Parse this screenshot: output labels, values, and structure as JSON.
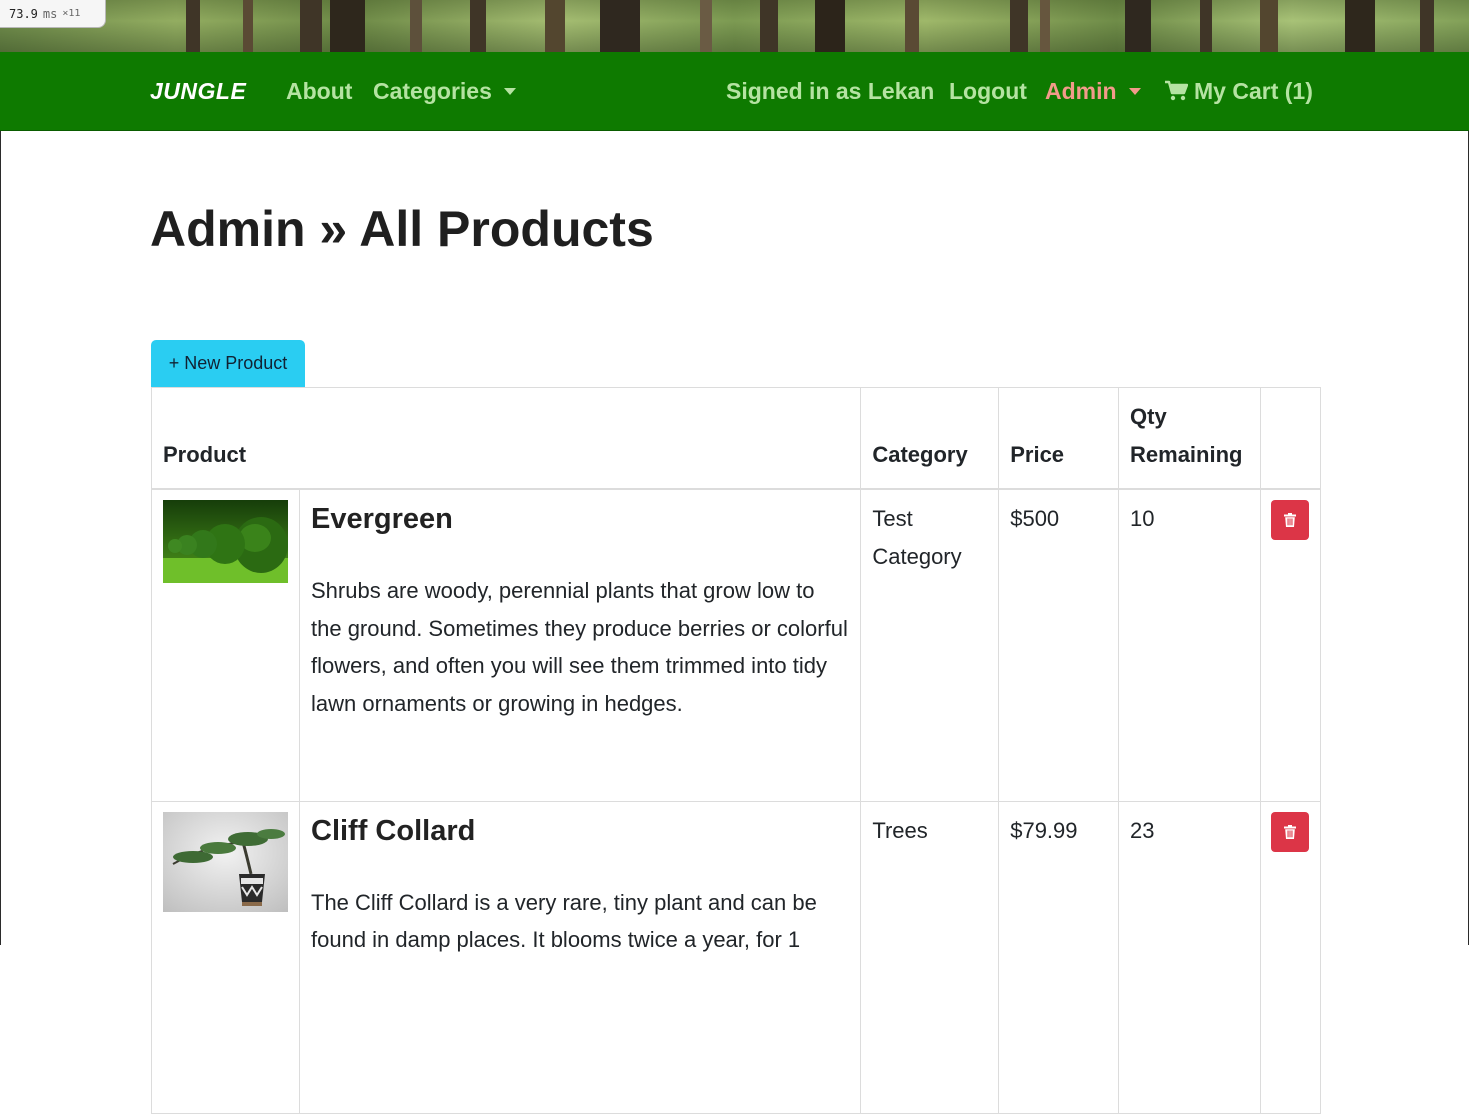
{
  "perf": {
    "value": "73.9",
    "unit": "ms",
    "multiplier": "×11"
  },
  "nav": {
    "brand": "JUNGLE",
    "about": "About",
    "categories": "Categories",
    "signed_in": "Signed in as Lekan",
    "logout": "Logout",
    "admin": "Admin",
    "cart": "My Cart (1)"
  },
  "page": {
    "title": "Admin » All Products",
    "new_button": "+ New Product"
  },
  "table": {
    "headers": {
      "product": "Product",
      "category": "Category",
      "price": "Price",
      "qty": "Qty Remaining"
    },
    "rows": [
      {
        "name": "Evergreen",
        "description": "Shrubs are woody, perennial plants that grow low to the ground. Sometimes they produce berries or colorful flowers, and often you will see them trimmed into tidy lawn ornaments or growing in hedges.",
        "category": "Test Category",
        "price": "$500",
        "qty": "10"
      },
      {
        "name": "Cliff Collard",
        "description": "The Cliff Collard is a very rare, tiny plant and can be found in damp places. It blooms twice a year, for 1",
        "category": "Trees",
        "price": "$79.99",
        "qty": "23"
      }
    ]
  },
  "colors": {
    "navbar": "#0e7a00",
    "nav_link": "#b5e3a2",
    "admin_link": "#f29b8a",
    "new_button": "#2acdf2",
    "delete_button": "#dc3547"
  },
  "icons": [
    "cart-icon",
    "caret-down-icon",
    "trash-icon"
  ]
}
